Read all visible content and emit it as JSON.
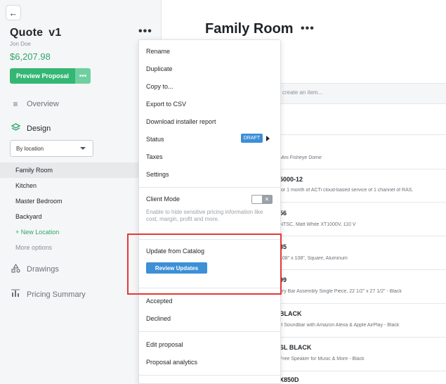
{
  "sidebar": {
    "back_icon": "arrow-left-icon",
    "quote_title": "Quote",
    "quote_version": "v1",
    "customer_name": "Jon Doe",
    "total": "$6,207.98",
    "preview_button_label": "Preview Proposal",
    "preview_more_label": "•••",
    "nav": {
      "overview": "Overview",
      "design": "Design",
      "drawings": "Drawings",
      "pricing_summary": "Pricing Summary"
    },
    "location_select_value": "By location",
    "locations": [
      "Family Room",
      "Kitchen",
      "Master Bedroom",
      "Backyard"
    ],
    "new_location_label": "+ New Location",
    "more_options_label": "More options"
  },
  "main": {
    "title": "Family Room",
    "create_placeholder": "create an item...",
    "items": [
      {
        "name": "",
        "desc": "Mini Fisheye Dome"
      },
      {
        "name": "5000-12",
        "desc": "for 1 month of ACTi cloud-based service of 1 channel of RAS."
      },
      {
        "name": "56",
        "desc": "NTSC, Matt White XT1000V, 110 V"
      },
      {
        "name": "85",
        "desc": "108\" x 108\", Square, Aluminum"
      },
      {
        "name": "99",
        "desc": "ery Bar Assembly Single Piece, 22 1/2\" x 27 1/2\" - Black"
      },
      {
        "name": "BLACK",
        "desc": "rt Soundbar with Amazon Alexa & Apple AirPlay - Black"
      },
      {
        "name": "SL BLACK",
        "desc": "Free Speaker for Music & More - Black"
      },
      {
        "name": "X850D",
        "desc": ""
      }
    ]
  },
  "menu": {
    "rename": "Rename",
    "duplicate": "Duplicate",
    "copy_to": "Copy to...",
    "export_csv": "Export to CSV",
    "download_installer": "Download installer report",
    "status": "Status",
    "status_badge": "DRAFT",
    "taxes": "Taxes",
    "settings": "Settings",
    "client_mode": "Client Mode",
    "client_mode_desc": "Enable to hide sensitive pricing information like cost, margin, profit and more.",
    "toggle_symbol": "✕",
    "update_from_catalog": "Update from Catalog",
    "review_updates": "Review Updates",
    "accepted": "Accepted",
    "declined": "Declined",
    "edit_proposal": "Edit proposal",
    "proposal_analytics": "Proposal analytics"
  },
  "colors": {
    "accent_green": "#35b774",
    "accent_blue": "#3d8fd6",
    "highlight_red": "#e53935"
  }
}
